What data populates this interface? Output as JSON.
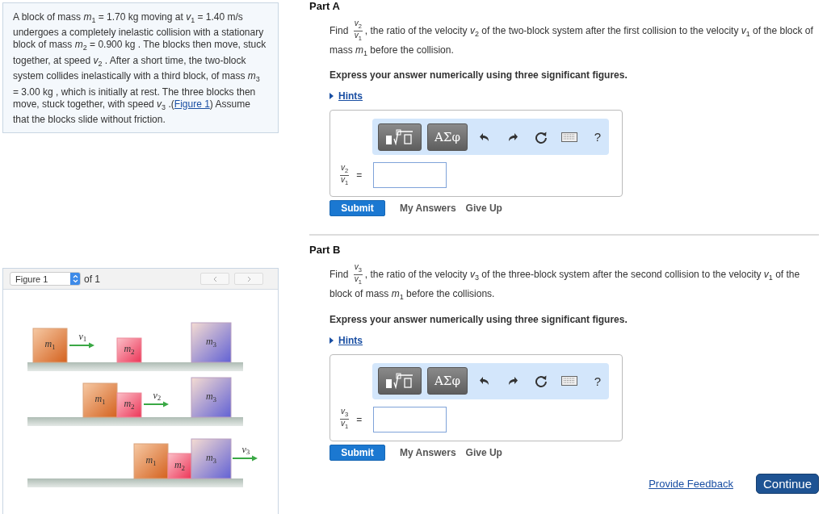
{
  "problem": {
    "text_before": "A block of mass *m*$_{1}$ = 1.70 kg moving at *v*$_{1}$ = 1.40 m/s undergoes a completely inelastic collision with a stationary block of mass *m*$_{2}$ = 0.900 kg . The blocks then move, stuck together, at speed *v*$_{2}$ . After a short time, the two-block system collides inelastically with a third block, of mass *m*$_{3}$ = 3.00 kg , which is initially at rest. The three blocks then move, stuck together, with speed *v*$_{3}$ .(",
    "link": "Figure 1",
    "text_after": ") Assume that the blocks slide without friction."
  },
  "figure": {
    "selector": "Figure 1",
    "of": "of 1",
    "rows": [
      {
        "blocks": [
          {
            "label": "m",
            "sub": "1"
          },
          {
            "label": "m",
            "sub": "2"
          },
          {
            "label": "m",
            "sub": "3"
          }
        ],
        "arrow": {
          "label": "v",
          "sub": "1"
        }
      },
      {
        "blocks": [
          {
            "label": "m",
            "sub": "1"
          },
          {
            "label": "m",
            "sub": "2"
          },
          {
            "label": "m",
            "sub": "3"
          }
        ],
        "arrow": {
          "label": "v",
          "sub": "2"
        }
      },
      {
        "blocks": [
          {
            "label": "m",
            "sub": "1"
          },
          {
            "label": "m",
            "sub": "2"
          },
          {
            "label": "m",
            "sub": "3"
          }
        ],
        "arrow": {
          "label": "v",
          "sub": "3"
        }
      }
    ]
  },
  "parts": [
    {
      "title": "Part A",
      "prompt": {
        "lead": "Find",
        "num": "*v*$_{2}$",
        "den": "*v*$_{1}$",
        "rest": ", the ratio of the velocity *v*$_{2}$ of the two-block system after the first collision to the velocity *v*$_{1}$ of the block of mass *m*$_{1}$ before the collision."
      },
      "instruction": "Express your answer numerically using three significant figures.",
      "hints": "Hints",
      "toolbar": {
        "greek": "ΑΣφ",
        "help": "?"
      },
      "answer_label": {
        "num": "*v*$_{2}$",
        "den": "*v*$_{1}$",
        "eq": "="
      },
      "submit": "Submit",
      "my_answers": "My Answers",
      "give_up": "Give Up"
    },
    {
      "title": "Part B",
      "prompt": {
        "lead": "Find",
        "num": "*v*$_{3}$",
        "den": "*v*$_{1}$",
        "rest": ", the ratio of the velocity *v*$_{3}$ of the three-block system after the second collision to the velocity *v*$_{1}$ of the block of mass *m*$_{1}$ before the collisions."
      },
      "instruction": "Express your answer numerically using three significant figures.",
      "hints": "Hints",
      "toolbar": {
        "greek": "ΑΣφ",
        "help": "?"
      },
      "answer_label": {
        "num": "*v*$_{3}$",
        "den": "*v*$_{1}$",
        "eq": "="
      },
      "submit": "Submit",
      "my_answers": "My Answers",
      "give_up": "Give Up"
    }
  ],
  "footer": {
    "feedback": "Provide Feedback",
    "continue": "Continue"
  }
}
